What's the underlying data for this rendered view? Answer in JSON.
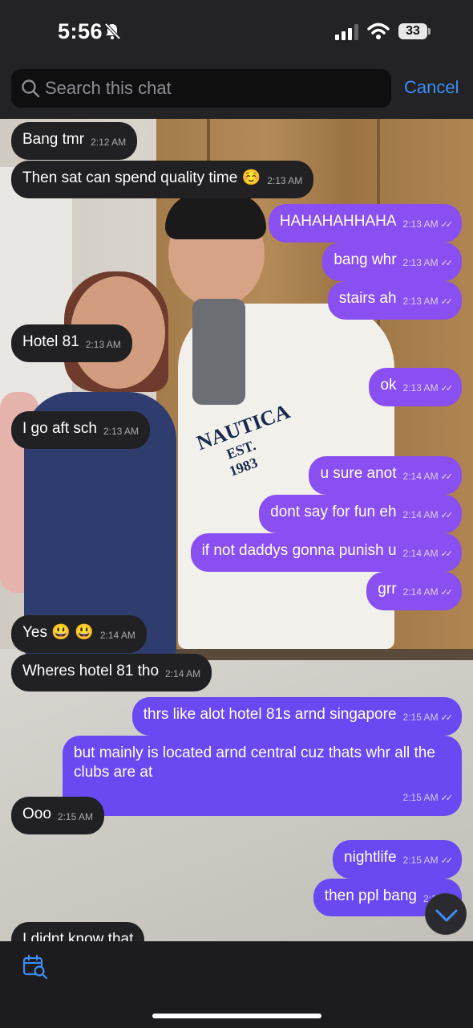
{
  "status_bar": {
    "time": "5:56",
    "battery": "33"
  },
  "search": {
    "placeholder": "Search this chat",
    "cancel_label": "Cancel"
  },
  "messages": [
    {
      "text": "Bang tmr",
      "time": "2:12 AM",
      "direction": "in"
    },
    {
      "text": "Then sat can spend quality time ☺️",
      "time": "2:13 AM",
      "direction": "in"
    },
    {
      "text": "HAHAHAHHAHA",
      "time": "2:13 AM",
      "direction": "out"
    },
    {
      "text": "bang whr",
      "time": "2:13 AM",
      "direction": "out"
    },
    {
      "text": "stairs ah",
      "time": "2:13 AM",
      "direction": "out"
    },
    {
      "text": "Hotel 81",
      "time": "2:13 AM",
      "direction": "in"
    },
    {
      "text": "ok",
      "time": "2:13 AM",
      "direction": "out"
    },
    {
      "text": "I go aft sch",
      "time": "2:13 AM",
      "direction": "in"
    },
    {
      "text": "u sure anot",
      "time": "2:14 AM",
      "direction": "out"
    },
    {
      "text": "dont say for fun eh",
      "time": "2:14 AM",
      "direction": "out"
    },
    {
      "text": "if not daddys gonna punish u",
      "time": "2:14 AM",
      "direction": "out"
    },
    {
      "text": "grr",
      "time": "2:14 AM",
      "direction": "out"
    },
    {
      "text": "Yes 😃 😃",
      "time": "2:14 AM",
      "direction": "in"
    },
    {
      "text": "Wheres hotel 81 tho",
      "time": "2:14 AM",
      "direction": "in"
    },
    {
      "text": "thrs like alot hotel 81s arnd singapore",
      "time": "2:15 AM",
      "direction": "out"
    },
    {
      "text": "but mainly is located arnd central cuz thats whr all the clubs are at",
      "time": "2:15 AM",
      "direction": "out"
    },
    {
      "text": "Ooo",
      "time": "2:15 AM",
      "direction": "in"
    },
    {
      "text": "nightlife",
      "time": "2:15 AM",
      "direction": "out"
    },
    {
      "text": "then ppl bang",
      "time": "2:15 A",
      "direction": "out"
    },
    {
      "text": "I didnt know that",
      "time": "",
      "direction": "in"
    }
  ],
  "wallpaper": {
    "shirt_text_1": "NAUTICA",
    "shirt_text_2": "EST.",
    "shirt_text_3": "1983"
  },
  "icons": {
    "bell": "bell-slash-icon",
    "signal": "signal-icon",
    "wifi": "wifi-icon",
    "search": "search-icon",
    "scroll_down": "chevron-down-icon",
    "calendar_search": "calendar-search-icon"
  },
  "colors": {
    "outgoing_bubble": "#8a4ff0",
    "incoming_bubble": "#212123",
    "accent": "#3d8df5"
  }
}
